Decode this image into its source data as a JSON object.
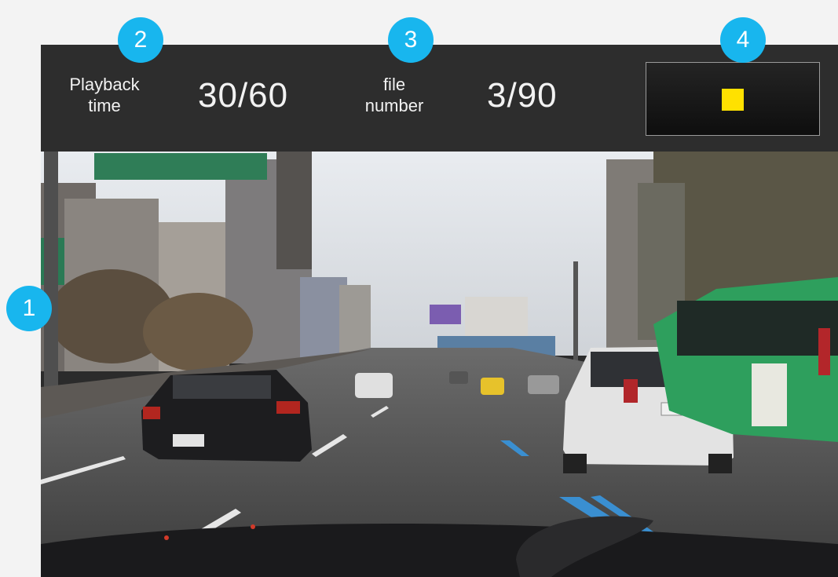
{
  "topbar": {
    "playback_label_line1": "Playback",
    "playback_label_line2": "time",
    "playback_value": "30/60",
    "file_label_line1": "file",
    "file_label_line2": "number",
    "file_value": "3/90",
    "stop_button_icon": "stop-icon",
    "stop_color": "#ffe100"
  },
  "markers": [
    "1",
    "2",
    "3",
    "4"
  ],
  "colors": {
    "marker": "#18b6ee",
    "bar": "#2d2d2d",
    "background": "#f3f3f3"
  }
}
